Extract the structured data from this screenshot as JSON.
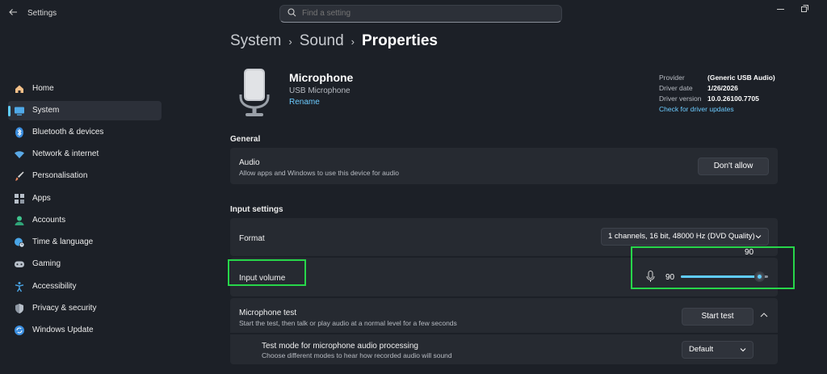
{
  "window": {
    "app_title": "Settings"
  },
  "search": {
    "placeholder": "Find a setting"
  },
  "breadcrumb": {
    "items": [
      "System",
      "Sound"
    ],
    "current": "Properties"
  },
  "sidebar": {
    "items": [
      {
        "label": "Home",
        "icon": "home-icon"
      },
      {
        "label": "System",
        "icon": "system-icon",
        "active": true
      },
      {
        "label": "Bluetooth & devices",
        "icon": "bluetooth-icon"
      },
      {
        "label": "Network & internet",
        "icon": "wifi-icon"
      },
      {
        "label": "Personalisation",
        "icon": "brush-icon"
      },
      {
        "label": "Apps",
        "icon": "apps-icon"
      },
      {
        "label": "Accounts",
        "icon": "accounts-icon"
      },
      {
        "label": "Time & language",
        "icon": "globe-clock-icon"
      },
      {
        "label": "Gaming",
        "icon": "gamepad-icon"
      },
      {
        "label": "Accessibility",
        "icon": "accessibility-icon"
      },
      {
        "label": "Privacy & security",
        "icon": "shield-icon"
      },
      {
        "label": "Windows Update",
        "icon": "update-icon"
      }
    ]
  },
  "device": {
    "name": "Microphone",
    "subtitle": "USB Microphone",
    "rename_label": "Rename"
  },
  "driver": {
    "provider_label": "Provider",
    "provider_value": "(Generic USB Audio)",
    "date_label": "Driver date",
    "date_value": "1/26/2026",
    "version_label": "Driver version",
    "version_value": "10.0.26100.7705",
    "updates_link": "Check for driver updates"
  },
  "general": {
    "section_title": "General",
    "audio_title": "Audio",
    "audio_desc": "Allow apps and Windows to use this device for audio",
    "audio_button": "Don't allow"
  },
  "input_settings": {
    "section_title": "Input settings",
    "format_label": "Format",
    "format_value": "1 channels, 16 bit, 48000 Hz (DVD Quality)",
    "volume_label": "Input volume",
    "volume_value": "90",
    "volume_tooltip": "90",
    "volume_level_percent": 90,
    "mic_test_title": "Microphone test",
    "mic_test_desc": "Start the test, then talk or play audio at a normal level for a few seconds",
    "mic_test_button": "Start test",
    "test_mode_title": "Test mode for microphone audio processing",
    "test_mode_desc": "Choose different modes to hear how recorded audio will sound",
    "test_mode_value": "Default"
  },
  "colors": {
    "background": "#1c2027",
    "card": "#262a31",
    "accent": "#60cdff",
    "highlight": "#27d64a"
  }
}
